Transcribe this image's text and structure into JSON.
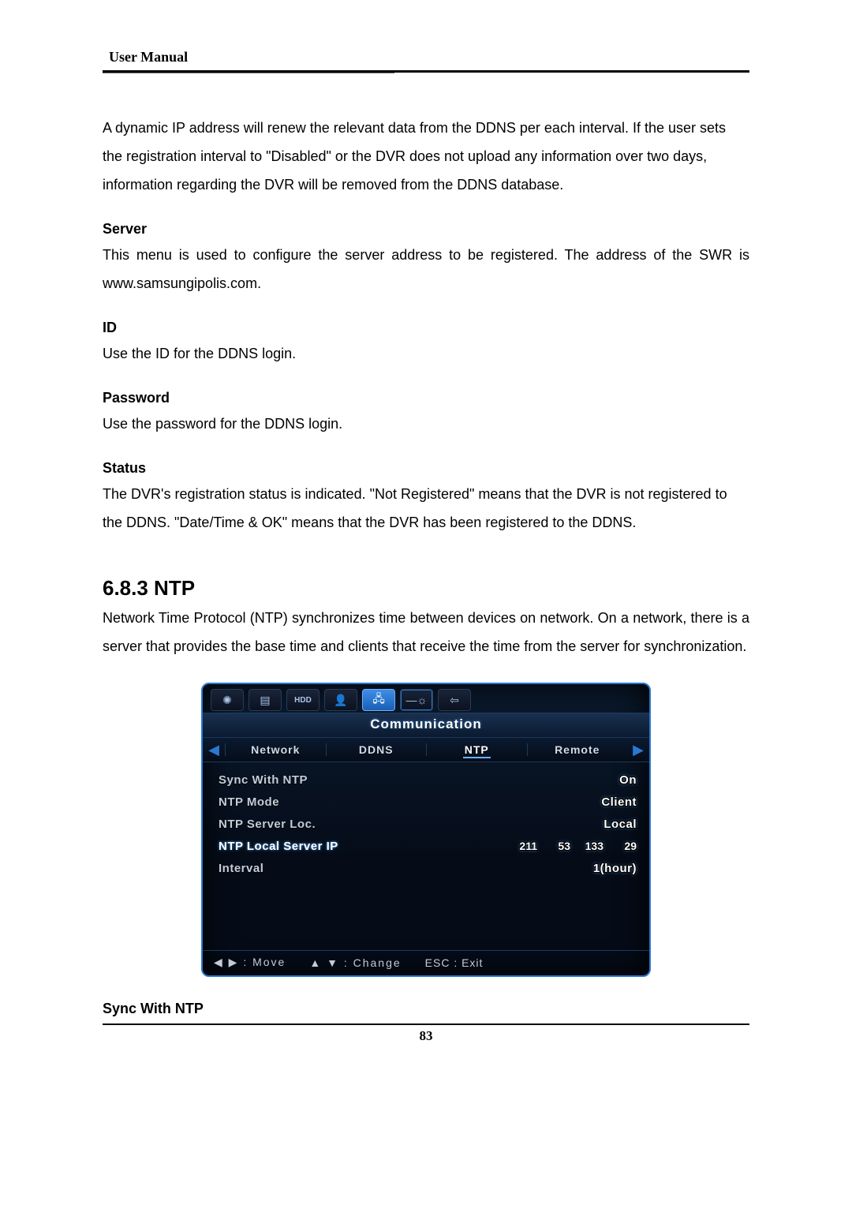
{
  "header": {
    "title": "User Manual"
  },
  "paragraphs": {
    "intro": "A dynamic IP address will renew the relevant data from the DDNS per each interval. If the user sets the registration interval to \"Disabled\" or the DVR does not upload any information over two days, information regarding the DVR will be removed from the DDNS database.",
    "server_heading": "Server",
    "server_body": "This menu is used to configure the server address to be registered. The address of the SWR is www.samsungipolis.com.",
    "id_heading": "ID",
    "id_body": "Use the ID for the DDNS login.",
    "password_heading": "Password",
    "password_body": "Use the password for the DDNS login.",
    "status_heading": "Status",
    "status_body": "The DVR's registration status is indicated. \"Not Registered\" means that the DVR is not registered to the DDNS. \"Date/Time & OK\" means that the DVR has been registered to the DDNS.",
    "ntp_heading": "6.8.3  NTP",
    "ntp_body": "Network Time Protocol (NTP) synchronizes time between devices on network. On a network, there is a server that provides the base time and clients that receive the time from the server for synchronization.",
    "sync_heading": "Sync With NTP"
  },
  "dvr": {
    "topicons": [
      {
        "name": "gear-icon",
        "glyph": "✺",
        "kind": "dark"
      },
      {
        "name": "display-icon",
        "glyph": "▤",
        "kind": "dark"
      },
      {
        "name": "hdd-icon",
        "glyph": "HDD",
        "kind": "dark"
      },
      {
        "name": "user-icon",
        "glyph": "👤",
        "kind": "dark"
      },
      {
        "name": "network-icon",
        "glyph": "🖧",
        "kind": "blue"
      },
      {
        "name": "brightness-icon",
        "glyph": "—☼",
        "kind": "dark"
      },
      {
        "name": "exit-icon",
        "glyph": "⇦",
        "kind": "dark"
      }
    ],
    "banner": "Communication",
    "tabs": [
      {
        "id": "network",
        "label": "Network",
        "active": false
      },
      {
        "id": "ddns",
        "label": "DDNS",
        "active": false
      },
      {
        "id": "ntp",
        "label": "NTP",
        "active": true
      },
      {
        "id": "remote",
        "label": "Remote",
        "active": false
      }
    ],
    "rows": [
      {
        "id": "sync",
        "label": "Sync With NTP",
        "value": "On",
        "selected": false
      },
      {
        "id": "mode",
        "label": "NTP Mode",
        "value": "Client",
        "selected": false
      },
      {
        "id": "loc",
        "label": "NTP Server Loc.",
        "value": "Local",
        "selected": false
      },
      {
        "id": "ip",
        "label": "NTP Local Server IP",
        "ip": [
          "211",
          "53",
          "133",
          "29"
        ],
        "selected": true
      },
      {
        "id": "interval",
        "label": "Interval",
        "value": "1(hour)",
        "selected": false
      }
    ],
    "footer": {
      "move": "◀ ▶ : Move",
      "change": "▲ ▼ : Change",
      "exit": "ESC : Exit"
    }
  },
  "page_number": "83"
}
